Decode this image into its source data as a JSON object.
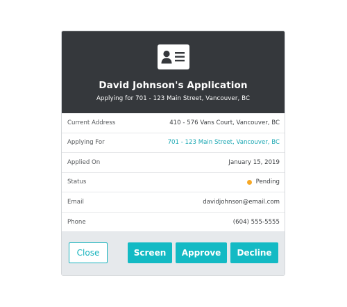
{
  "header": {
    "title": "David Johnson's Application",
    "subtitle": "Applying for 701 - 123 Main Street, Vancouver, BC",
    "icon": "id-card-icon",
    "background_color": "#35383c"
  },
  "details": [
    {
      "label": "Current Address",
      "value": "410 - 576 Vans Court, Vancouver, BC"
    },
    {
      "label": "Applying For",
      "value": "701 - 123 Main Street, Vancouver, BC"
    },
    {
      "label": "Applied On",
      "value": "January 15, 2019"
    },
    {
      "label": "Status",
      "value": "Pending",
      "status_color": "#f7a826"
    },
    {
      "label": "Email",
      "value": "davidjohnson@email.com"
    },
    {
      "label": "Phone",
      "value": "(604) 555-5555"
    }
  ],
  "actions": {
    "close_label": "Close",
    "screen_label": "Screen",
    "approve_label": "Approve",
    "decline_label": "Decline",
    "accent_color": "#13bac4"
  }
}
